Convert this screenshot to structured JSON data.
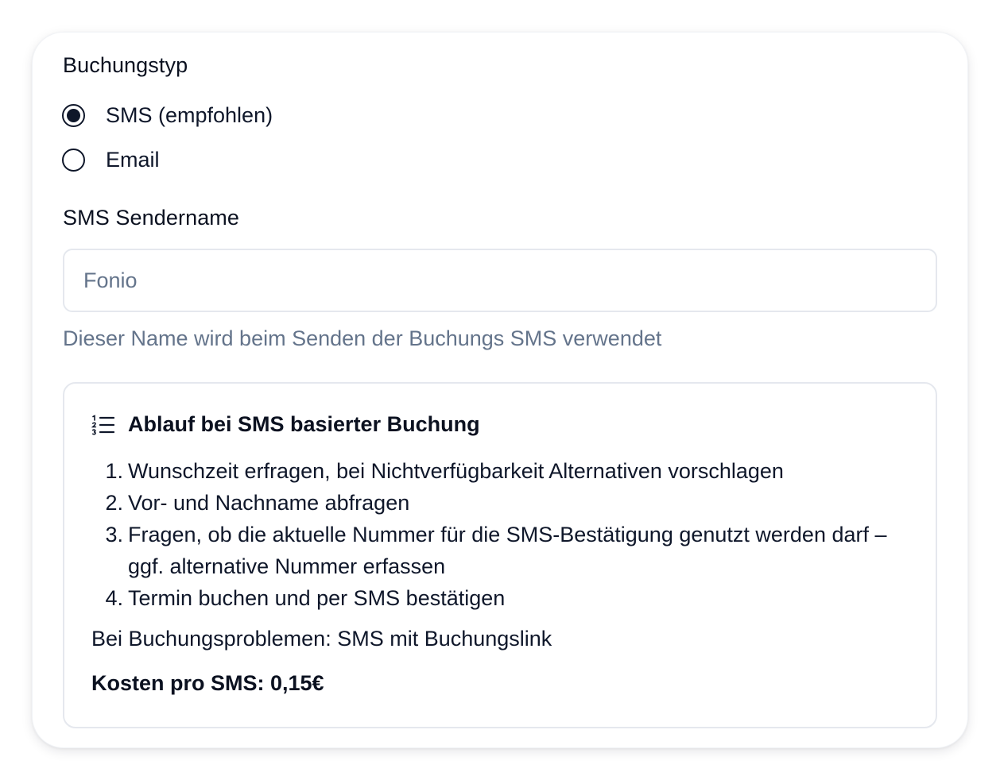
{
  "booking_type": {
    "label": "Buchungstyp",
    "options": [
      {
        "label": "SMS (empfohlen)",
        "selected": true
      },
      {
        "label": "Email",
        "selected": false
      }
    ]
  },
  "sender": {
    "label": "SMS Sendername",
    "placeholder": "Fonio",
    "value": "",
    "help": "Dieser Name wird beim Senden der Buchungs SMS verwendet"
  },
  "info": {
    "icon": "list-ordered-icon",
    "title": "Ablauf bei SMS basierter Buchung",
    "steps": [
      {
        "num": "1.",
        "text": "Wunschzeit erfragen, bei Nichtverfügbarkeit Alternativen vorschlagen"
      },
      {
        "num": "2.",
        "text": "Vor- und Nachname abfragen"
      },
      {
        "num": "3.",
        "text": "Fragen, ob die aktuelle Nummer für die SMS-Bestätigung genutzt werden darf – ggf. alternative Nummer erfassen"
      },
      {
        "num": "4.",
        "text": "Termin buchen und per SMS bestätigen"
      }
    ],
    "fallback": "Bei Buchungsproblemen: SMS mit Buchungslink",
    "cost": "Kosten pro SMS: 0,15€"
  },
  "colors": {
    "text": "#0f172a",
    "muted": "#64748b",
    "border": "#e5e8ee"
  }
}
